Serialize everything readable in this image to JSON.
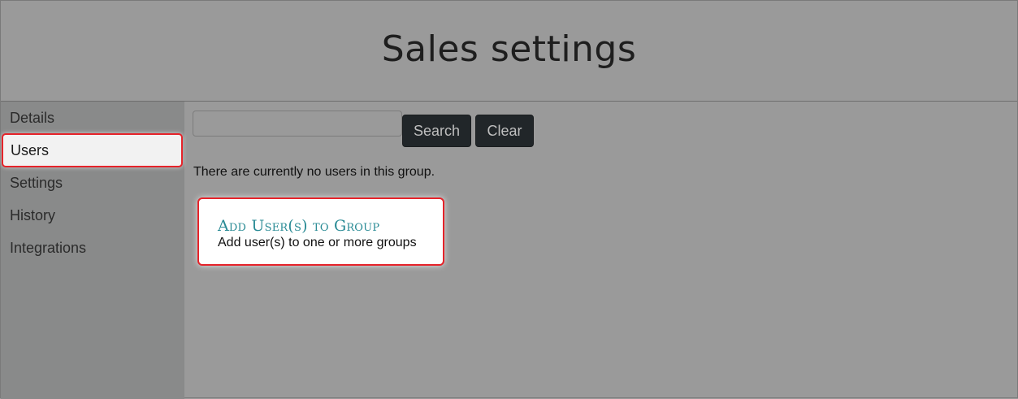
{
  "header": {
    "title": "Sales settings"
  },
  "sidebar": {
    "items": [
      {
        "label": "Details"
      },
      {
        "label": "Users",
        "active": true
      },
      {
        "label": "Settings"
      },
      {
        "label": "History"
      },
      {
        "label": "Integrations"
      }
    ]
  },
  "search": {
    "value": "",
    "placeholder": "",
    "search_label": "Search",
    "clear_label": "Clear"
  },
  "main": {
    "empty_message": "There are currently no users in this group.",
    "card": {
      "title": "Add User(s) to Group",
      "description": "Add user(s) to one or more groups"
    }
  },
  "colors": {
    "highlight_border": "#e5232a",
    "card_title": "#2a8b95",
    "button_bg": "#212629"
  }
}
